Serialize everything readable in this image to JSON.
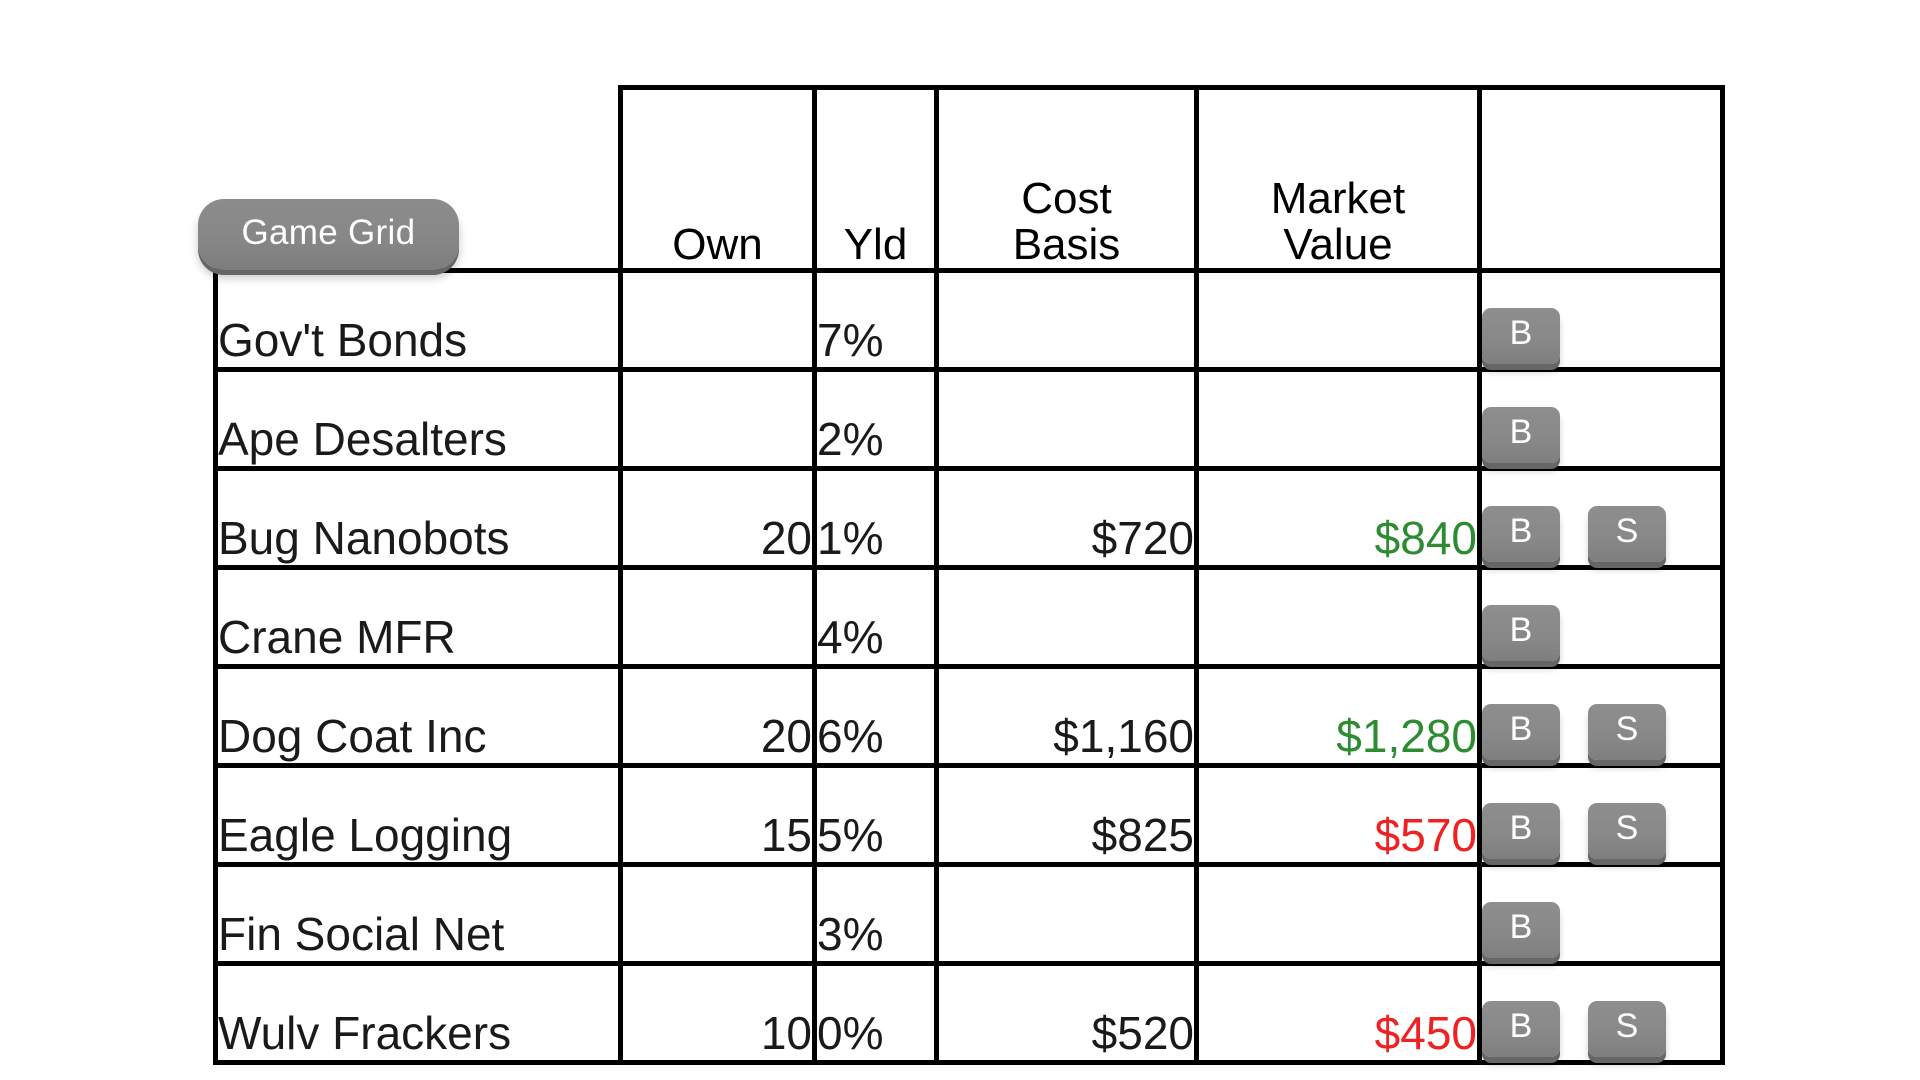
{
  "title_button": {
    "label": "Game Grid",
    "color": "#878787",
    "text_color": "#ffffff"
  },
  "colors": {
    "gain": "#2d8b32",
    "loss": "#ee2222",
    "border": "#000000",
    "button": "#878787"
  },
  "table": {
    "headers": {
      "name": "",
      "own": "Own",
      "yld": "Yld",
      "cost_basis": "Cost Basis",
      "cost_basis_line1": "Cost",
      "cost_basis_line2": "Basis",
      "market_value": "Market Value",
      "market_value_line1": "Market",
      "market_value_line2": "Value",
      "actions": ""
    },
    "buttons": {
      "buy_label": "B",
      "sell_label": "S"
    },
    "rows": [
      {
        "name": "Gov't Bonds",
        "own": "",
        "yld": "7%",
        "cost_basis": "",
        "market_value": "",
        "market_trend": "none",
        "actions": [
          "B"
        ]
      },
      {
        "name": "Ape Desalters",
        "own": "",
        "yld": "2%",
        "cost_basis": "",
        "market_value": "",
        "market_trend": "none",
        "actions": [
          "B"
        ]
      },
      {
        "name": "Bug Nanobots",
        "own": "20",
        "yld": "1%",
        "cost_basis": "$720",
        "market_value": "$840",
        "market_trend": "up",
        "actions": [
          "B",
          "S"
        ]
      },
      {
        "name": "Crane MFR",
        "own": "",
        "yld": "4%",
        "cost_basis": "",
        "market_value": "",
        "market_trend": "none",
        "actions": [
          "B"
        ]
      },
      {
        "name": "Dog Coat Inc",
        "own": "20",
        "yld": "6%",
        "cost_basis": "$1,160",
        "market_value": "$1,280",
        "market_trend": "up",
        "actions": [
          "B",
          "S"
        ]
      },
      {
        "name": "Eagle Logging",
        "own": "15",
        "yld": "5%",
        "cost_basis": "$825",
        "market_value": "$570",
        "market_trend": "down",
        "actions": [
          "B",
          "S"
        ]
      },
      {
        "name": "Fin Social Net",
        "own": "",
        "yld": "3%",
        "cost_basis": "",
        "market_value": "",
        "market_trend": "none",
        "actions": [
          "B"
        ]
      },
      {
        "name": "Wulv Frackers",
        "own": "10",
        "yld": "0%",
        "cost_basis": "$520",
        "market_value": "$450",
        "market_trend": "down",
        "actions": [
          "B",
          "S"
        ]
      }
    ]
  }
}
